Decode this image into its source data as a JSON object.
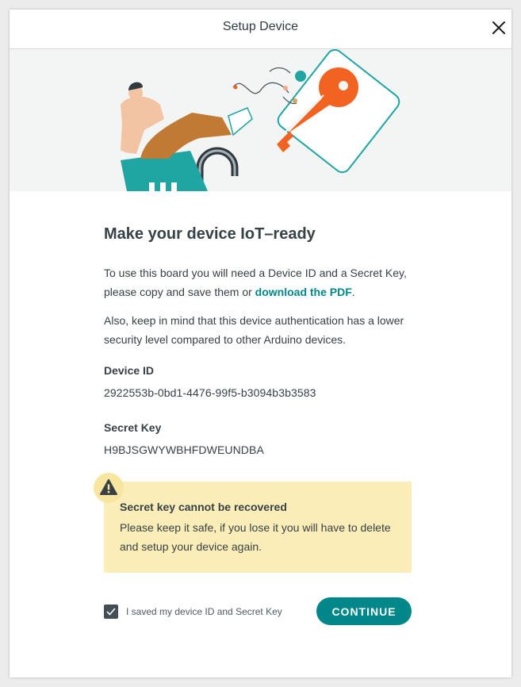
{
  "header": {
    "title": "Setup Device",
    "close_icon": "close-icon"
  },
  "hero": {
    "illustration": "person-with-lock-and-key-illustration"
  },
  "main": {
    "heading": "Make your device IoT–ready",
    "paragraph1_before": "To use this board you will need a Device ID and a Secret Key, please copy and save them or ",
    "paragraph1_link": "download the PDF",
    "paragraph1_after": ".",
    "paragraph2": "Also, keep in mind that this device authentication has a lower security level compared to other Arduino devices.",
    "device_id_label": "Device ID",
    "device_id_value": "2922553b-0bd1-4476-99f5-b3094b3b3583",
    "secret_key_label": "Secret Key",
    "secret_key_value": "H9BJSGWYWBHFDWEUNDBA"
  },
  "warning": {
    "icon": "warning-triangle-icon",
    "title": "Secret key cannot be recovered",
    "text": "Please keep it safe, if you lose it you will have to delete and setup your device again."
  },
  "footer": {
    "checkbox_checked": true,
    "checkbox_label": "I saved my device ID and Secret Key",
    "continue_label": "CONTINUE"
  },
  "colors": {
    "accent": "#00878a",
    "key_orange": "#f26322",
    "lock_teal": "#1fa5a2",
    "warning_bg": "#fbedb8",
    "text": "#374146"
  }
}
